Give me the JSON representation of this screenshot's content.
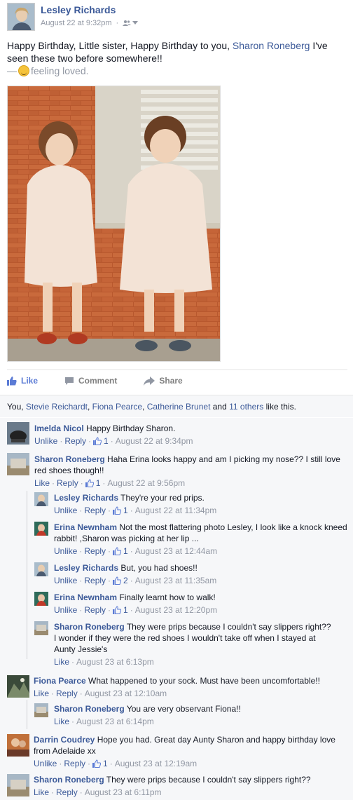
{
  "post": {
    "author": "Lesley Richards",
    "timestamp": "August 22 at 9:32pm",
    "audience_icon": "friends-icon",
    "text_before_tag": "Happy Birthday, Little sister, Happy Birthday to you, ",
    "tagged_name": "Sharon Roneberg",
    "text_after_tag": " I've seen these two before somewhere!!",
    "feeling_prefix": "— ",
    "feeling_text": "feeling loved."
  },
  "actions": {
    "like": "Like",
    "comment": "Comment",
    "share": "Share"
  },
  "likes": {
    "you": "You",
    "names": [
      "Stevie Reichardt",
      "Fiona Pearce",
      "Catherine Brunet"
    ],
    "sep1": ", ",
    "sep2": ", ",
    "sep3": ", ",
    "and": " and ",
    "others": "11 others",
    "suffix": " like this."
  },
  "comments": [
    {
      "name": "Imelda Nicol",
      "text": "Happy Birthday Sharon.",
      "action": "Unlike",
      "reply": "Reply",
      "likes": "1",
      "time": "August 22 at 9:34pm"
    },
    {
      "name": "Sharon Roneberg",
      "text": "Haha Erina looks happy and am I picking my nose?? I still love red shoes though!!",
      "action": "Like",
      "reply": "Reply",
      "likes": "1",
      "time": "August 22 at 9:56pm"
    },
    {
      "name": "Lesley Richards",
      "text": "They're your red prips.",
      "action": "Unlike",
      "reply": "Reply",
      "likes": "1",
      "time": "August 22 at 11:34pm"
    },
    {
      "name": "Erina Newnham",
      "text": "Not the most flattering photo Lesley, I look like a knock kneed rabbit! ,Sharon was picking at her lip ...",
      "action": "Unlike",
      "reply": "Reply",
      "likes": "1",
      "time": "August 23 at 12:44am"
    },
    {
      "name": "Lesley Richards",
      "text": "But, you had shoes!!",
      "action": "Unlike",
      "reply": "Reply",
      "likes": "2",
      "time": "August 23 at 11:35am"
    },
    {
      "name": "Erina Newnham",
      "text": "Finally learnt how to walk!",
      "action": "Unlike",
      "reply": "Reply",
      "likes": "1",
      "time": "August 23 at 12:20pm"
    },
    {
      "name": "Sharon Roneberg",
      "text": "They were prips because I couldn't say slippers right?? I wonder if they were the red shoes I wouldn't take off when I stayed at Aunty Jessie's",
      "action": "Like",
      "time": "August 23 at 6:13pm"
    },
    {
      "name": "Fiona Pearce",
      "text": "What happened to your sock. Must have been uncomfortable!!",
      "action": "Like",
      "reply": "Reply",
      "time": "August 23 at 12:10am"
    },
    {
      "name": "Sharon Roneberg",
      "text": "You are very observant Fiona!!",
      "action": "Like",
      "time": "August 23 at 6:14pm"
    },
    {
      "name": "Darrin Coudrey",
      "text": "Hope you had. Great day Aunty Sharon and happy birthday love from Adelaide xx",
      "action": "Unlike",
      "reply": "Reply",
      "likes": "1",
      "time": "August 23 at 12:19am"
    },
    {
      "name": "Sharon Roneberg",
      "text": "They were prips because I couldn't say slippers right??",
      "action": "Like",
      "reply": "Reply",
      "time": "August 23 at 6:11pm"
    }
  ],
  "colors": {
    "link": "#3b5998",
    "meta": "#9197a3",
    "like_active": "#5b7bd5"
  }
}
